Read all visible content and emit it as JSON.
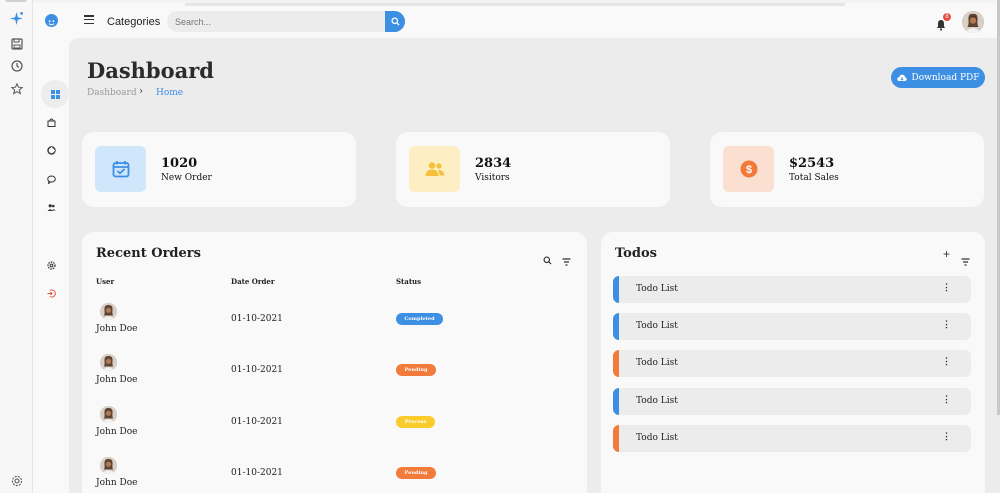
{
  "nav": {
    "categories_label": "Categories"
  },
  "search": {
    "placeholder": "Search..."
  },
  "notifications": {
    "count": "8"
  },
  "page": {
    "title": "Dashboard",
    "breadcrumb": [
      "Dashboard",
      "Home"
    ]
  },
  "actions": {
    "download_label": "Download PDF"
  },
  "stats": [
    {
      "value": "1020",
      "label": "New Order",
      "icon": "calendar-check-icon",
      "color": "#3d8fe3",
      "bg": "#cfe6fb"
    },
    {
      "value": "2834",
      "label": "Visitors",
      "icon": "people-icon",
      "color": "#f5c13d",
      "bg": "#fdefc3"
    },
    {
      "value": "$2543",
      "label": "Total Sales",
      "icon": "dollar-circle-icon",
      "color": "#f27a3a",
      "bg": "#fbe0d2"
    }
  ],
  "orders": {
    "title": "Recent Orders",
    "columns": [
      "User",
      "Date Order",
      "Status"
    ],
    "rows": [
      {
        "user": "John Doe",
        "date": "01-10-2021",
        "status": "Completed",
        "color": "#3d8fe3"
      },
      {
        "user": "John Doe",
        "date": "01-10-2021",
        "status": "Pending",
        "color": "#f27a3a"
      },
      {
        "user": "John Doe",
        "date": "01-10-2021",
        "status": "Process",
        "color": "#f9cc2c"
      },
      {
        "user": "John Doe",
        "date": "01-10-2021",
        "status": "Pending",
        "color": "#f27a3a"
      }
    ]
  },
  "todos": {
    "title": "Todos",
    "items": [
      {
        "text": "Todo List",
        "color": "#3d8fe3"
      },
      {
        "text": "Todo List",
        "color": "#3d8fe3"
      },
      {
        "text": "Todo List",
        "color": "#f27a3a"
      },
      {
        "text": "Todo List",
        "color": "#3d8fe3"
      },
      {
        "text": "Todo List",
        "color": "#f27a3a"
      }
    ]
  }
}
